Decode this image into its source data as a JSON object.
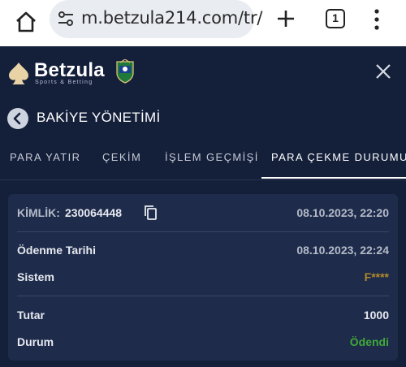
{
  "browser": {
    "url": "m.betzula214.com/tr/",
    "tab_count": "1"
  },
  "app": {
    "brand_name": "Betzula",
    "brand_sub": "Sports & Betting"
  },
  "page": {
    "title": "BAKİYE YÖNETİMİ"
  },
  "tabs": [
    {
      "label": "PARA YATIR",
      "active": false
    },
    {
      "label": "ÇEKİM",
      "active": false
    },
    {
      "label": "İŞLEM GEÇMİŞİ",
      "active": false
    },
    {
      "label": "PARA ÇEKME DURUMU",
      "active": true
    }
  ],
  "withdrawal": {
    "id_label": "KİMLİK:",
    "id_value": "230064448",
    "created_at": "08.10.2023, 22:20",
    "payment_date_label": "Ödenme Tarihi",
    "payment_date_value": "08.10.2023, 22:24",
    "system_label": "Sistem",
    "system_value": "F****",
    "amount_label": "Tutar",
    "amount_value": "1000",
    "status_label": "Durum",
    "status_value": "Ödendi"
  },
  "colors": {
    "background": "#141f3a",
    "card": "#1e2b4a",
    "system_value": "#b08a2a",
    "status_paid": "#3fa83a"
  }
}
